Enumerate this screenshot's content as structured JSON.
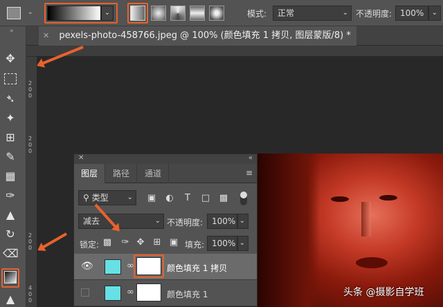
{
  "options_bar": {
    "mode_label": "模式:",
    "mode_value": "正常",
    "opacity_label": "不透明度:",
    "opacity_value": "100%"
  },
  "document_tab": {
    "title": "pexels-photo-458766.jpeg @ 100% (颜色填充 1 拷贝, 图层蒙版/8) *"
  },
  "vertical_ruler_labels": [
    "2",
    "0",
    "0",
    "2",
    "0",
    "0",
    "2",
    "0",
    "0",
    "4",
    "0",
    "0"
  ],
  "layers_panel": {
    "tabs": [
      "图层",
      "路径",
      "通道"
    ],
    "filter_label": "类型",
    "blend_mode": "减去",
    "opacity_label": "不透明度:",
    "opacity_value": "100%",
    "lock_label": "锁定:",
    "fill_label": "填充:",
    "fill_value": "100%",
    "layers": [
      {
        "name": "颜色填充 1 拷贝",
        "visible": true,
        "selected": true
      },
      {
        "name": "颜色填充 1",
        "visible": false,
        "selected": false
      }
    ],
    "thumb_color": "#66e0e4"
  },
  "watermark": "头条 @摄影自学班",
  "colors": {
    "annotation": "#e8622c",
    "photo_tint": "#c43a26"
  }
}
